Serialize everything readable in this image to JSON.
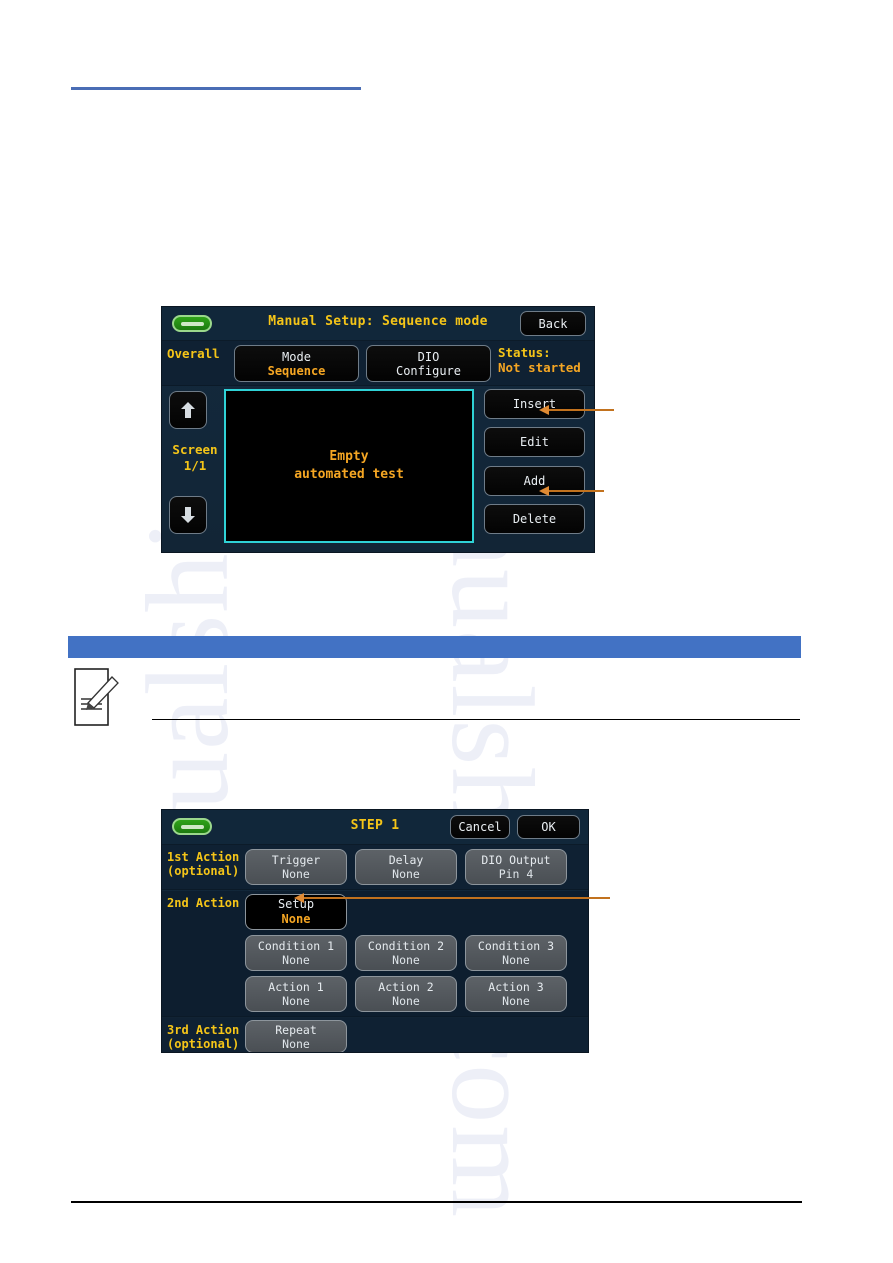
{
  "document": {
    "top_rule": "",
    "blue_band": "",
    "note_icon": "note-pencil-icon",
    "footer_rule": ""
  },
  "screen1": {
    "title": "Manual Setup: Sequence mode",
    "led": "power-led",
    "back_label": "Back",
    "overall_label": "Overall",
    "mode_button": {
      "line1": "Mode",
      "line2": "Sequence"
    },
    "dio_button": {
      "line1": "DIO",
      "line2": "Configure"
    },
    "status": {
      "label": "Status:",
      "value": "Not started"
    },
    "nav": {
      "up": "↑",
      "down": "↓",
      "screen_label": "Screen",
      "screen_value": "1/1"
    },
    "test_area": {
      "line1": "Empty",
      "line2": "automated test"
    },
    "side_buttons": {
      "insert": "Insert",
      "edit": "Edit",
      "add": "Add",
      "delete": "Delete"
    },
    "callouts": {
      "insert": "",
      "add": ""
    }
  },
  "screen2": {
    "title": "STEP 1",
    "led": "power-led",
    "cancel_label": "Cancel",
    "ok_label": "OK",
    "row1": {
      "label_line1": "1st Action",
      "label_line2": "(optional)",
      "buttons": [
        {
          "line1": "Trigger",
          "line2": "None"
        },
        {
          "line1": "Delay",
          "line2": "None"
        },
        {
          "line1": "DIO Output",
          "line2": "Pin 4"
        }
      ]
    },
    "row2": {
      "label_line1": "2nd Action",
      "label_line2": "",
      "setup": {
        "line1": "Setup",
        "line2": "None"
      },
      "conditions": [
        {
          "line1": "Condition 1",
          "line2": "None"
        },
        {
          "line1": "Condition 2",
          "line2": "None"
        },
        {
          "line1": "Condition 3",
          "line2": "None"
        }
      ],
      "actions": [
        {
          "line1": "Action 1",
          "line2": "None"
        },
        {
          "line1": "Action 2",
          "line2": "None"
        },
        {
          "line1": "Action 3",
          "line2": "None"
        }
      ]
    },
    "row3": {
      "label_line1": "3rd Action",
      "label_line2": "(optional)",
      "repeat": {
        "line1": "Repeat",
        "line2": "None"
      }
    },
    "callouts": {
      "setup": ""
    }
  },
  "colors": {
    "amber": "#f5a623",
    "yellow": "#f5c518",
    "cyan_border": "#2fd2d6",
    "panel_bg": "#122a3e",
    "band_blue": "#4272c4",
    "callout_orange": "#e08a33"
  }
}
